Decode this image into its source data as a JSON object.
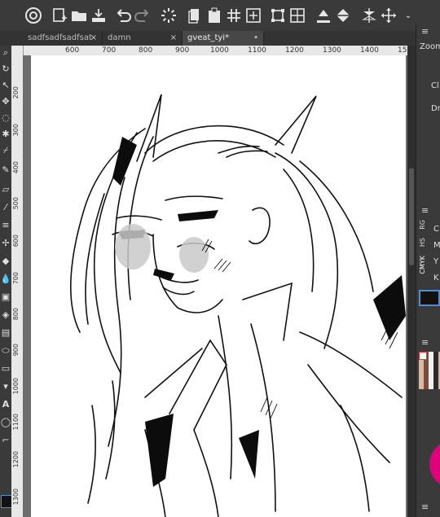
{
  "tabs": [
    {
      "label": "sadfsadfsadfsat",
      "close": "×",
      "active": false
    },
    {
      "label": "damn",
      "close": "×",
      "active": false
    },
    {
      "label": "gveat_tyi*",
      "close": "•",
      "active": true
    }
  ],
  "ruler_top": [
    "600",
    "700",
    "800",
    "900",
    "1000",
    "1100",
    "1200",
    "1300",
    "1400",
    "15"
  ],
  "ruler_left": [
    "200",
    "300",
    "400",
    "500",
    "600",
    "700",
    "800",
    "900",
    "1000",
    "1100",
    "1200",
    "1300"
  ],
  "right_panel": {
    "zoom_label": "Zoom",
    "cl_label": "Cl",
    "dr_label": "Dr",
    "color_tabs": [
      "RG",
      "HS",
      "CMYK"
    ],
    "cmyk_letters": [
      "C",
      "M",
      "Y",
      "K"
    ]
  },
  "colors": {
    "accent": "#4a8fd8",
    "ui_dark": "#2b2b2b",
    "panel": "#3a3a3a",
    "color_wheel": "#e0007a"
  }
}
